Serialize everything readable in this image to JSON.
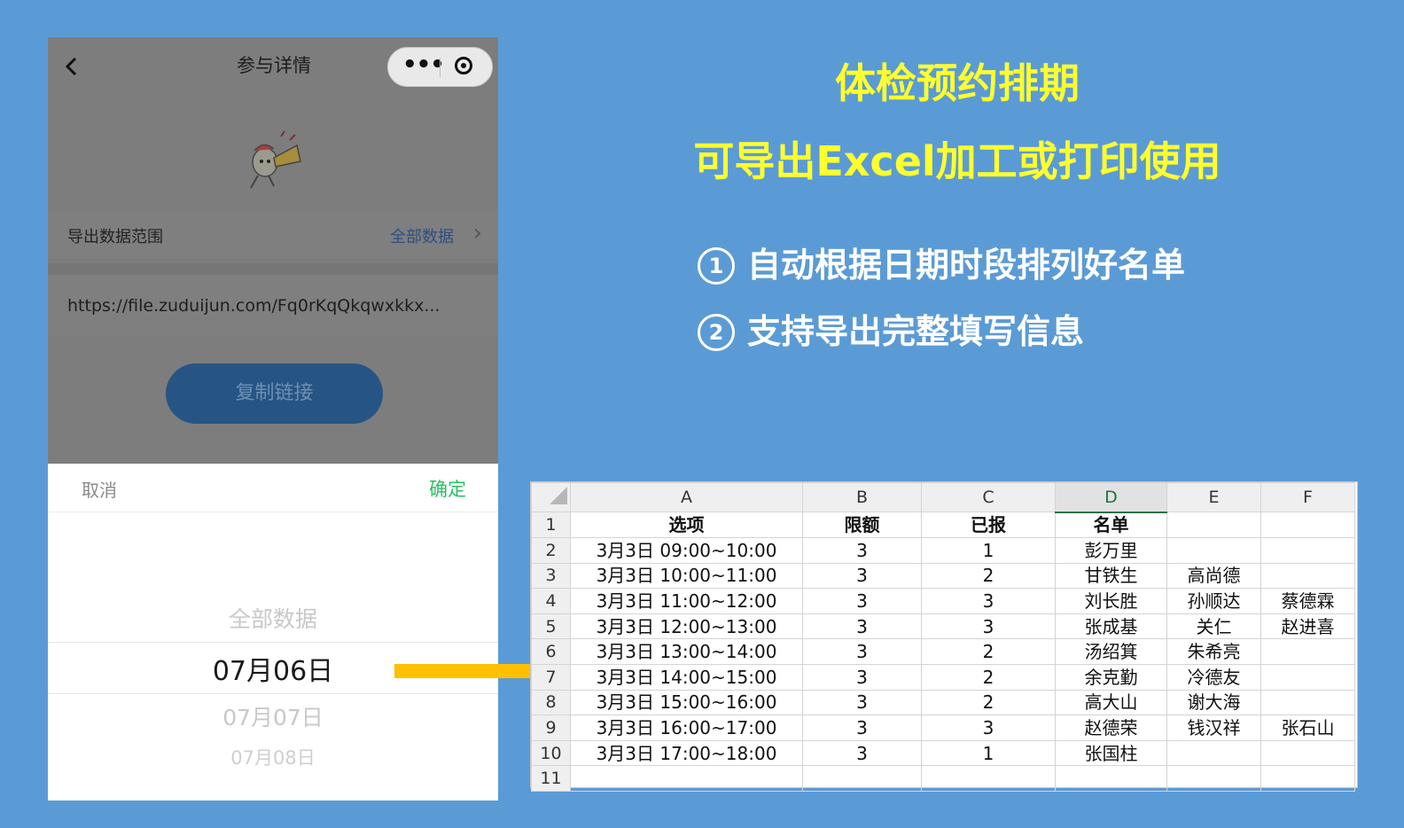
{
  "phone": {
    "nav_title": "参与详情",
    "back_icon": "chevron-left-icon",
    "menu_icon": "more-dots-icon",
    "close_icon": "target-icon",
    "range_label": "导出数据范围",
    "range_value": "全部数据",
    "url": "https://file.zuduijun.com/Fq0rKqQkqwxkkx...",
    "copy_button": "复制链接",
    "picker": {
      "cancel": "取消",
      "confirm": "确定",
      "options": [
        "全部数据",
        "07月06日",
        "07月07日",
        "07月08日"
      ],
      "selected": "07月06日"
    }
  },
  "headline": {
    "line1": "体检预约排期",
    "line2": "可导出Excel加工或打印使用",
    "bullet1_num": "1",
    "bullet1": "自动根据日期时段排列好名单",
    "bullet2_num": "2",
    "bullet2": "支持导出完整填写信息"
  },
  "colors": {
    "background": "#5b9bd5",
    "headline": "#ffff2e",
    "arrow": "#ffc000",
    "confirm_green": "#2bbf60",
    "copy_button": "#265585"
  },
  "sheet": {
    "columns": [
      "A",
      "B",
      "C",
      "D",
      "E",
      "F"
    ],
    "rows": [
      [
        "选项",
        "限额",
        "已报",
        "名单",
        "",
        ""
      ],
      [
        "3月3日 09:00~10:00",
        "3",
        "1",
        "彭万里",
        "",
        ""
      ],
      [
        "3月3日 10:00~11:00",
        "3",
        "2",
        "甘铁生",
        "高尚德",
        ""
      ],
      [
        "3月3日 11:00~12:00",
        "3",
        "3",
        "刘长胜",
        "孙顺达",
        "蔡德霖"
      ],
      [
        "3月3日 12:00~13:00",
        "3",
        "3",
        "张成基",
        "关仁",
        "赵进喜"
      ],
      [
        "3月3日 13:00~14:00",
        "3",
        "2",
        "汤绍箕",
        "朱希亮",
        ""
      ],
      [
        "3月3日 14:00~15:00",
        "3",
        "2",
        "余克勤",
        "冷德友",
        ""
      ],
      [
        "3月3日 15:00~16:00",
        "3",
        "2",
        "高大山",
        "谢大海",
        ""
      ],
      [
        "3月3日 16:00~17:00",
        "3",
        "3",
        "赵德荣",
        "钱汉祥",
        "张石山"
      ],
      [
        "3月3日 17:00~18:00",
        "3",
        "1",
        "张国柱",
        "",
        ""
      ],
      [
        "",
        "",
        "",
        "",
        "",
        ""
      ]
    ],
    "row_numbers": [
      "1",
      "2",
      "3",
      "4",
      "5",
      "6",
      "7",
      "8",
      "9",
      "10",
      "11"
    ],
    "selected_column": "D"
  }
}
